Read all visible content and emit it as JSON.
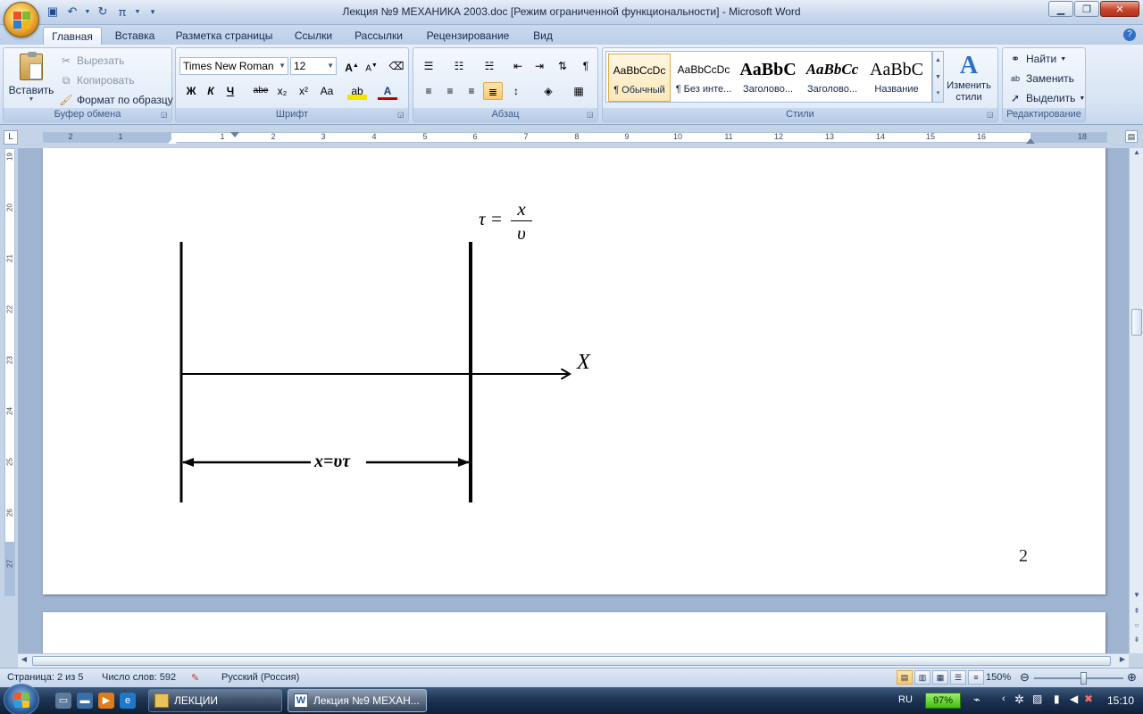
{
  "window": {
    "title": "Лекция №9 МЕХАНИКА 2003.doc [Режим ограниченной функциональности]  -  Microsoft Word"
  },
  "tabs": [
    "Главная",
    "Вставка",
    "Разметка страницы",
    "Ссылки",
    "Рассылки",
    "Рецензирование",
    "Вид"
  ],
  "clipboard": {
    "paste": "Вставить",
    "cut": "Вырезать",
    "copy": "Копировать",
    "format_painter": "Формат по образцу",
    "group": "Буфер обмена"
  },
  "font": {
    "name": "Times New Roman",
    "size": "12",
    "group": "Шрифт",
    "bold": "Ж",
    "italic": "К",
    "underline": "Ч",
    "strike": "abe",
    "sub": "x₂",
    "sup": "x²",
    "case": "Aa"
  },
  "paragraph": {
    "group": "Абзац"
  },
  "styles": {
    "group": "Стили",
    "change_styles": "Изменить стили",
    "items": [
      {
        "preview": "AaBbCcDc",
        "name": "¶ Обычный"
      },
      {
        "preview": "AaBbCcDc",
        "name": "¶ Без инте..."
      },
      {
        "preview": "AaBbC",
        "name": "Заголово..."
      },
      {
        "preview": "AaBbCc",
        "name": "Заголово..."
      },
      {
        "preview": "AaBbC",
        "name": "Название"
      }
    ]
  },
  "editing": {
    "find": "Найти",
    "replace": "Заменить",
    "select": "Выделить",
    "group": "Редактирование"
  },
  "ruler": {
    "h_numbers": [
      "2",
      "1",
      "1",
      "2",
      "3",
      "4",
      "5",
      "6",
      "7",
      "8",
      "9",
      "10",
      "11",
      "12",
      "13",
      "14",
      "15",
      "16",
      "18"
    ],
    "v_numbers": [
      "19",
      "20",
      "21",
      "22",
      "23",
      "24",
      "25",
      "26",
      "27"
    ]
  },
  "document": {
    "formula_lhs": "τ =",
    "formula_num": "x",
    "formula_den": "υ",
    "axis_label": "X",
    "distance_label": "x=υτ",
    "page_number": "2"
  },
  "status": {
    "page": "Страница: 2 из 5",
    "words": "Число слов: 592",
    "language": "Русский (Россия)",
    "zoom": "150%"
  },
  "taskbar": {
    "tasks": [
      "ЛЕКЦИИ",
      "Лекция №9 МЕХАН..."
    ],
    "lang": "RU",
    "battery": "97%",
    "clock": "15:10"
  },
  "colors": {
    "accent": "#2e6fc7",
    "selected_style": "#f8c96a"
  }
}
